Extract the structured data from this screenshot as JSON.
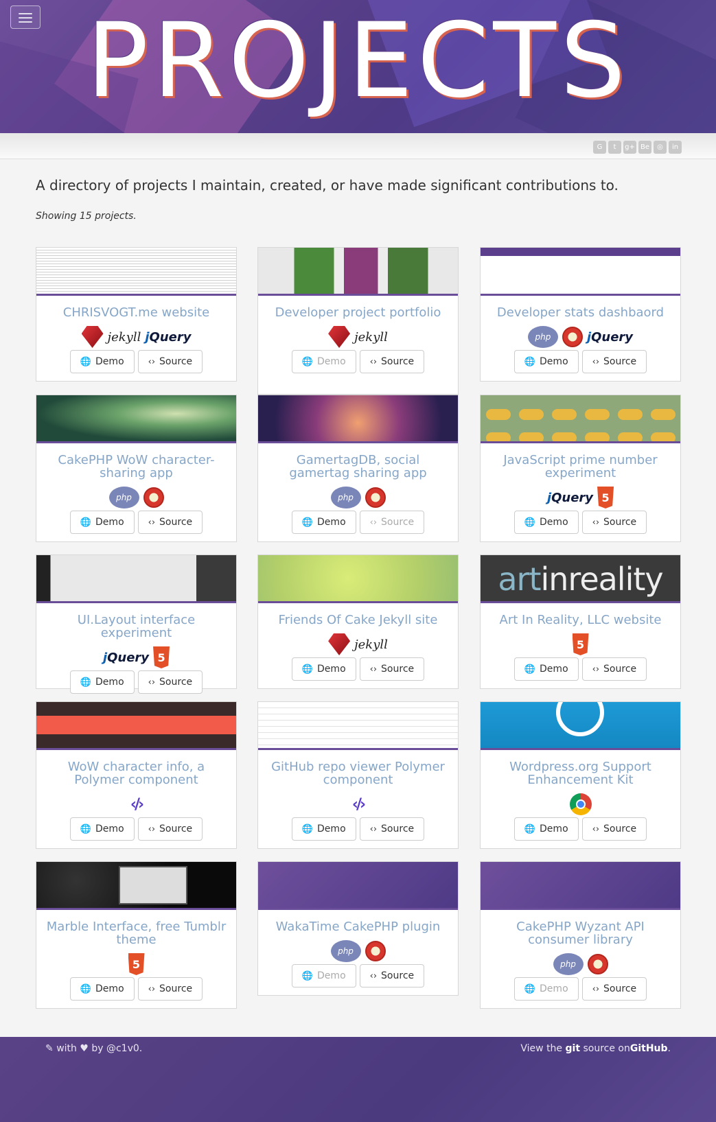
{
  "header": {
    "title": "PROJECTS",
    "menu_label": "Toggle navigation"
  },
  "social": [
    {
      "icon": "github-icon",
      "glyph": "G"
    },
    {
      "icon": "twitter-icon",
      "glyph": "t"
    },
    {
      "icon": "google-plus-icon",
      "glyph": "g+"
    },
    {
      "icon": "behance-icon",
      "glyph": "Be"
    },
    {
      "icon": "instagram-icon",
      "glyph": "◎"
    },
    {
      "icon": "linkedin-icon",
      "glyph": "in"
    }
  ],
  "intro": {
    "lead": "A directory of projects I maintain, created, or have made significant contributions to.",
    "count": "Showing 15 projects."
  },
  "buttons": {
    "demo": "Demo",
    "source": "Source"
  },
  "logo_text": {
    "jekyll": "jekyll",
    "jquery_a": "j",
    "jquery_b": "Query",
    "php": "php",
    "html5": "5",
    "polymer": "‹/›"
  },
  "art_text": {
    "a": "art",
    "b": "inreality"
  },
  "projects": [
    {
      "title": "CHRISVOGT.me website",
      "tech": [
        "ruby",
        "jekyll",
        "jquery"
      ],
      "demo_enabled": true,
      "source_enabled": true
    },
    {
      "title": "Developer project portfolio",
      "tech": [
        "ruby",
        "jekyll"
      ],
      "demo_enabled": false,
      "source_enabled": true
    },
    {
      "title": "Developer stats dashbaord",
      "tech": [
        "php",
        "cakephp",
        "jquery"
      ],
      "demo_enabled": true,
      "source_enabled": true
    },
    {
      "title": "CakePHP WoW character-sharing app",
      "tech": [
        "php",
        "cakephp"
      ],
      "demo_enabled": true,
      "source_enabled": true
    },
    {
      "title": "GamertagDB, social gamertag sharing app",
      "tech": [
        "php",
        "cakephp"
      ],
      "demo_enabled": true,
      "source_enabled": false
    },
    {
      "title": "JavaScript prime number experiment",
      "tech": [
        "jquery",
        "html5"
      ],
      "demo_enabled": true,
      "source_enabled": true
    },
    {
      "title": "UI.Layout interface experiment",
      "tech": [
        "jquery",
        "html5"
      ],
      "demo_enabled": true,
      "source_enabled": true
    },
    {
      "title": "Friends Of Cake Jekyll site",
      "tech": [
        "ruby",
        "jekyll"
      ],
      "demo_enabled": true,
      "source_enabled": true
    },
    {
      "title": "Art In Reality, LLC website",
      "tech": [
        "html5"
      ],
      "demo_enabled": true,
      "source_enabled": true
    },
    {
      "title": "WoW character info, a Polymer component",
      "tech": [
        "polymer"
      ],
      "demo_enabled": true,
      "source_enabled": true
    },
    {
      "title": "GitHub repo viewer Polymer component",
      "tech": [
        "polymer"
      ],
      "demo_enabled": true,
      "source_enabled": true
    },
    {
      "title": "Wordpress.org Support Enhancement Kit",
      "tech": [
        "chrome"
      ],
      "demo_enabled": true,
      "source_enabled": true
    },
    {
      "title": "Marble Interface, free Tumblr theme",
      "tech": [
        "html5"
      ],
      "demo_enabled": true,
      "source_enabled": true
    },
    {
      "title": "WakaTime CakePHP plugin",
      "tech": [
        "php",
        "cakephp"
      ],
      "demo_enabled": false,
      "source_enabled": true
    },
    {
      "title": "CakePHP Wyzant API consumer library",
      "tech": [
        "php",
        "cakephp"
      ],
      "demo_enabled": false,
      "source_enabled": true
    }
  ],
  "footer": {
    "left_a": "with",
    "left_b": "by @c1v0.",
    "right_a": "View the",
    "right_git": "git",
    "right_b": "source on",
    "right_github": "GitHub",
    "right_c": "."
  }
}
